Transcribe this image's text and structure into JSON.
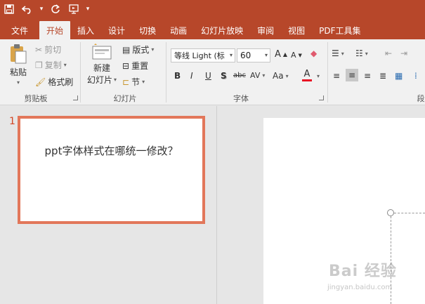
{
  "quick_access": {
    "save_icon": "save-icon",
    "undo_icon": "undo-icon",
    "redo_icon": "redo-icon",
    "present_icon": "start-from-beginning-icon",
    "customize_icon": "customize-qat-icon"
  },
  "tabs": [
    {
      "label": "文件"
    },
    {
      "label": "开始"
    },
    {
      "label": "插入"
    },
    {
      "label": "设计"
    },
    {
      "label": "切换"
    },
    {
      "label": "动画"
    },
    {
      "label": "幻灯片放映"
    },
    {
      "label": "审阅"
    },
    {
      "label": "视图"
    },
    {
      "label": "PDF工具集"
    }
  ],
  "ribbon": {
    "clipboard": {
      "paste": "粘贴",
      "cut": "剪切",
      "copy": "复制",
      "format_painter": "格式刷",
      "label": "剪贴板"
    },
    "slides": {
      "new_slide_line1": "新建",
      "new_slide_line2": "幻灯片",
      "layout": "版式",
      "reset": "重置",
      "section": "节",
      "label": "幻灯片"
    },
    "font": {
      "font_name": "等线 Light (标",
      "font_size": "60",
      "bold": "B",
      "italic": "I",
      "underline": "U",
      "shadow": "S",
      "strike": "abc",
      "spacing": "AV",
      "case": "Aa",
      "color": "A",
      "grow": "A",
      "shrink": "A",
      "label": "字体"
    },
    "paragraph": {
      "label": "段"
    }
  },
  "slides_pane": {
    "slide_number": "1",
    "thumb_text": "ppt字体样式在哪统一修改？"
  },
  "watermark": {
    "main": "Bai 经验",
    "sub": "jingyan.baidu.com"
  },
  "colors": {
    "accent": "#b7472a",
    "ribbon_bg": "#f1f1f1",
    "thumb_border": "#e2775a",
    "font_color_bar": "#e81123"
  }
}
